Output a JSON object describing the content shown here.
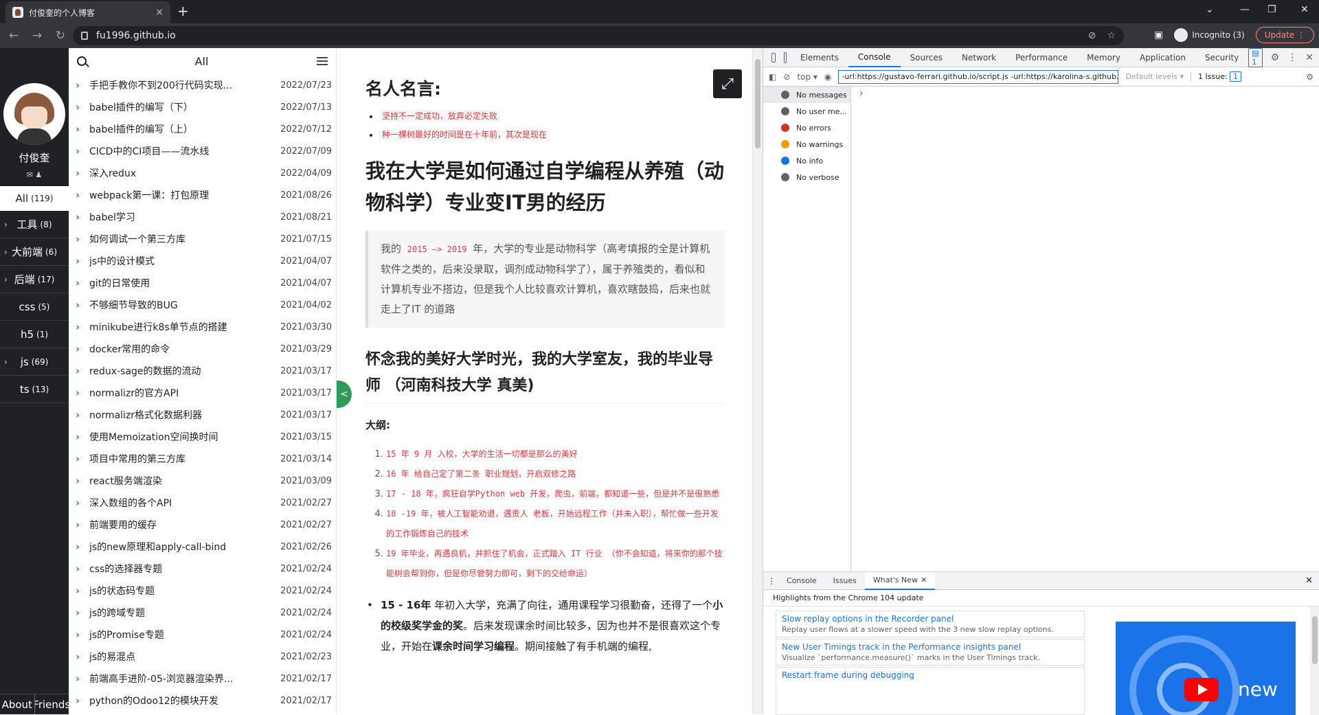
{
  "browser": {
    "tab_title": "付俊奎的个人博客",
    "tab_close": "×",
    "new_tab": "+",
    "url": "fu1996.github.io",
    "incognito_label": "Incognito (3)",
    "update_label": "Update"
  },
  "sidebar": {
    "owner_name": "付俊奎",
    "all_label": "All",
    "all_count": "(119)",
    "categories": [
      {
        "label": "工具",
        "count": "(8)",
        "arrow": "›"
      },
      {
        "label": "大前端",
        "count": "(6)",
        "arrow": "›"
      },
      {
        "label": "后端",
        "count": "(17)",
        "arrow": "›"
      },
      {
        "label": "css",
        "count": "(5)",
        "arrow": ""
      },
      {
        "label": "h5",
        "count": "(1)",
        "arrow": ""
      },
      {
        "label": "js",
        "count": "(69)",
        "arrow": "›"
      },
      {
        "label": "ts",
        "count": "(13)",
        "arrow": ""
      }
    ],
    "about_label": "About",
    "friends_label": "Friends"
  },
  "postlist": {
    "header_label": "All",
    "posts": [
      {
        "title": "手把手教你不到200行代码实现...",
        "date": "2022/07/23"
      },
      {
        "title": "babel插件的编写（下）",
        "date": "2022/07/13"
      },
      {
        "title": "babel插件的编写（上）",
        "date": "2022/07/12"
      },
      {
        "title": "CICD中的CI项目——流水线",
        "date": "2022/07/09"
      },
      {
        "title": "深入redux",
        "date": "2022/04/09"
      },
      {
        "title": "webpack第一课：打包原理",
        "date": "2021/08/26"
      },
      {
        "title": "babel学习",
        "date": "2021/08/21"
      },
      {
        "title": "如何调试一个第三方库",
        "date": "2021/07/15"
      },
      {
        "title": "js中的设计模式",
        "date": "2021/04/07"
      },
      {
        "title": "git的日常使用",
        "date": "2021/04/07"
      },
      {
        "title": "不够细节导致的BUG",
        "date": "2021/04/02"
      },
      {
        "title": "minikube进行k8s单节点的搭建",
        "date": "2021/03/30"
      },
      {
        "title": "docker常用的命令",
        "date": "2021/03/29"
      },
      {
        "title": "redux-sage的数据的流动",
        "date": "2021/03/17"
      },
      {
        "title": "normalizr的官方API",
        "date": "2021/03/17"
      },
      {
        "title": "normalizr格式化数据利器",
        "date": "2021/03/17"
      },
      {
        "title": "使用Memoization空间换时间",
        "date": "2021/03/15"
      },
      {
        "title": "项目中常用的第三方库",
        "date": "2021/03/14"
      },
      {
        "title": "react服务端渲染",
        "date": "2021/03/09"
      },
      {
        "title": "深入数组的各个API",
        "date": "2021/02/27"
      },
      {
        "title": "前端要用的缓存",
        "date": "2021/02/27"
      },
      {
        "title": "js的new原理和apply-call-bind",
        "date": "2021/02/26"
      },
      {
        "title": "css的选择器专题",
        "date": "2021/02/24"
      },
      {
        "title": "js的状态码专题",
        "date": "2021/02/24"
      },
      {
        "title": "js的跨域专题",
        "date": "2021/02/24"
      },
      {
        "title": "js的Promise专题",
        "date": "2021/02/24"
      },
      {
        "title": "js的易混点",
        "date": "2021/02/23"
      },
      {
        "title": "前端高手进阶-05-浏览器渲染界...",
        "date": "2021/02/17"
      },
      {
        "title": "python的Odoo12的模块开发",
        "date": "2021/02/17"
      }
    ],
    "collapse_label": "<"
  },
  "article": {
    "quotes_heading": "名人名言:",
    "quotes": [
      "坚持不一定成功，放弃必定失败",
      "种一棵树最好的时间是在十年前，其次是现在"
    ],
    "title": "我在大学是如何通过自学编程从养殖（动物科学）专业变IT男的经历",
    "intro_prefix": "我的",
    "intro_code": "2015 —> 2019",
    "intro_rest": "年，大学的专业是动物科学（高考填报的全是计算机软件之类的，后来没录取，调剂成动物科学了），属于养殖类的，看似和计算机专业不搭边，但是我个人比较喜欢计算机，喜欢瞎鼓捣，后来也就走上了IT 的道路",
    "section_title": "怀念我的美好大学时光，我的大学室友，我的毕业导师 （河南科技大学 真美)",
    "outline_label": "大纲:",
    "outline": [
      "15 年 9 月 入校，大学的生活一切都是那么的美好",
      "16 年 给自己定了第二条 职业规划，开启双修之路",
      "17 - 18 年，疯狂自学Python web 开发，爬虫，前端，都知道一些，但是并不是很熟悉",
      "18 -19 年，被人工智能劝退，遇贵人 老板，开始远程工作（并未入职），帮忙做一些开发的工作锻炼自己的技术",
      "19 年毕业，再遇良机，并抓住了机会，正式踏入 IT 行业 （你不会知道，将来你的那个技能树会帮到你，但是你尽管努力即可，剩下的交给命运）"
    ],
    "para_bold1": "15 - 16年",
    "para_text1": "年初入大学，充满了向往，通用课程学习很勤奋，还得了一个",
    "para_bold2": "小的校级奖学金的奖",
    "para_text2": "。后来发现课余时间比较多，因为也并不是很喜欢这个专业，开始在",
    "para_bold3": "课余时间学习编程",
    "para_text3": "。期间接触了有手机端的编程,"
  },
  "devtools": {
    "tabs": [
      "Elements",
      "Console",
      "Sources",
      "Network",
      "Performance",
      "Memory",
      "Application",
      "Security"
    ],
    "active_tab": "Console",
    "issue_badge_count": "1",
    "context": "top",
    "filter_value": "-url:https://gustavo-ferrari.github.io/script.js -url:https://karolina-s.github.io",
    "levels_label": "Default levels",
    "issues_label": "1 Issue:",
    "issues_count": "1",
    "sidebar": [
      {
        "label": "No messages",
        "icon": "list-icon",
        "color": "#5f6368"
      },
      {
        "label": "No user me...",
        "icon": "user-icon",
        "color": "#5f6368"
      },
      {
        "label": "No errors",
        "icon": "error-icon",
        "color": "#d93025"
      },
      {
        "label": "No warnings",
        "icon": "warning-icon",
        "color": "#f29900"
      },
      {
        "label": "No info",
        "icon": "info-icon",
        "color": "#1a73e8"
      },
      {
        "label": "No verbose",
        "icon": "gear-icon",
        "color": "#5f6368"
      }
    ],
    "prompt": "›",
    "drawer_tabs": [
      "Console",
      "Issues",
      "What's New"
    ],
    "drawer_active": "What's New",
    "drawer_heading": "Highlights from the Chrome 104 update",
    "whats_new": [
      {
        "title": "Slow replay options in the Recorder panel",
        "desc": "Replay user flows at a slower speed with the 3 new slow replay options."
      },
      {
        "title": "New User Timings track in the Performance insights panel",
        "desc": "Visualize `performance.measure()` marks in the User Timings track."
      },
      {
        "title": "Restart frame during debugging",
        "desc": ""
      }
    ],
    "video_label": "new"
  }
}
